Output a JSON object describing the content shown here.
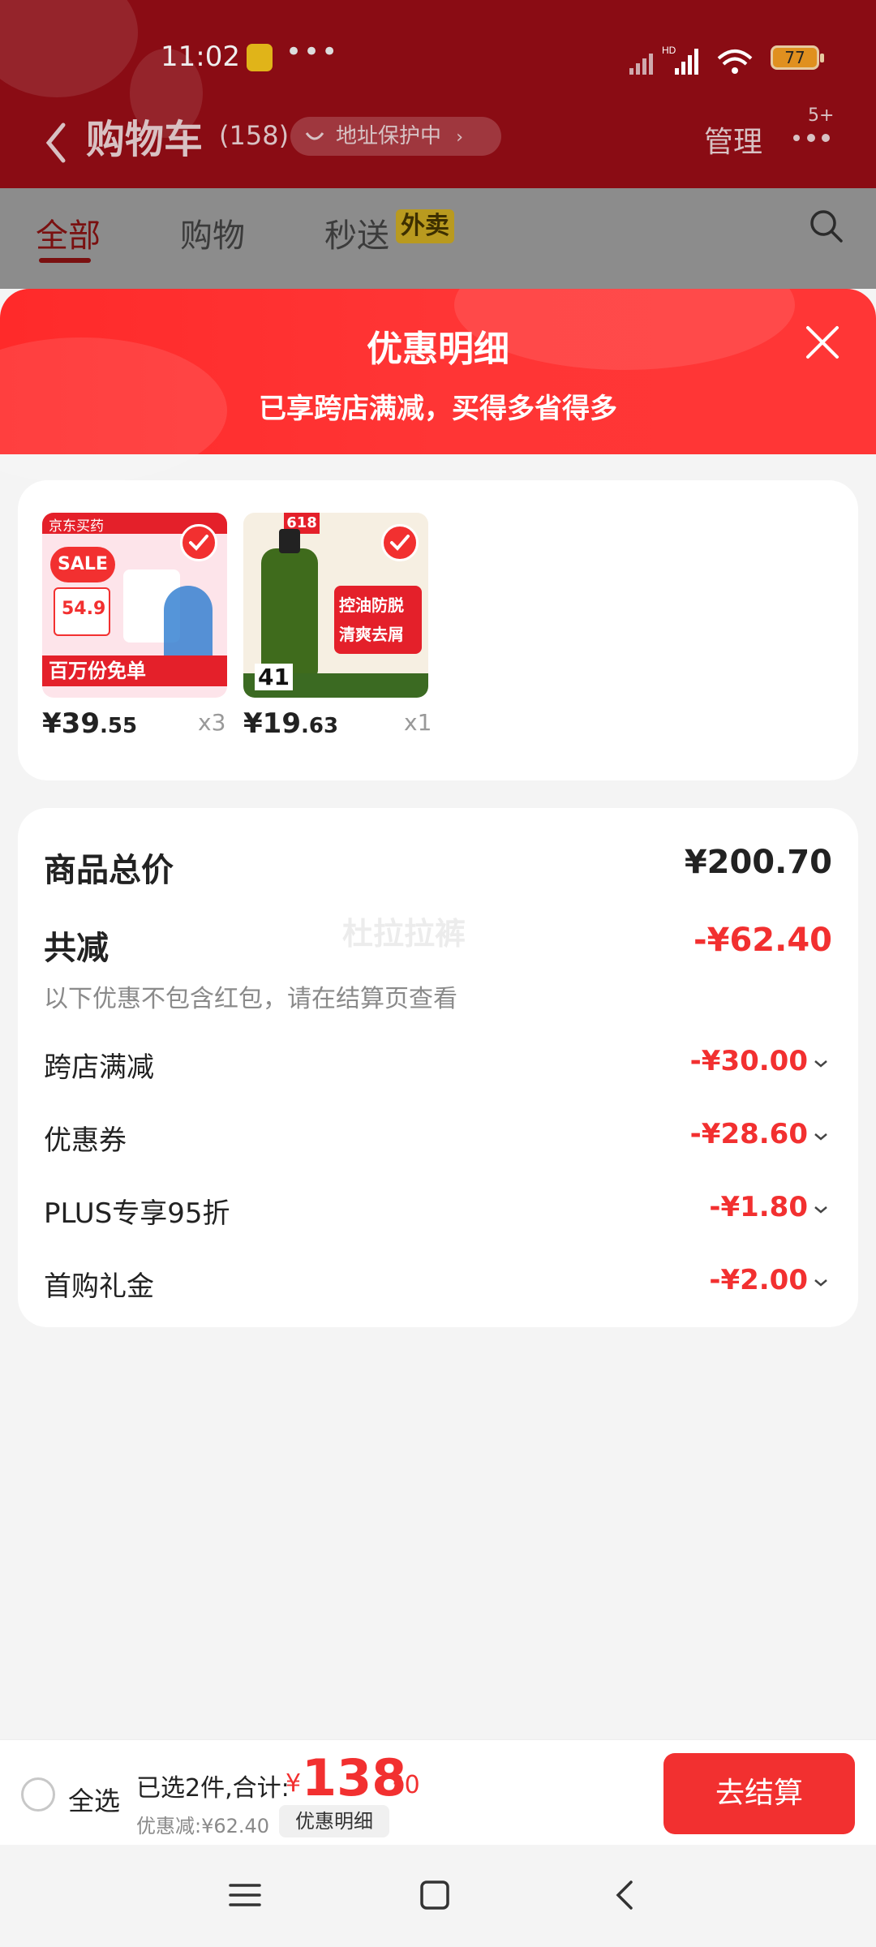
{
  "status_bar": {
    "time": "11:02",
    "dots": "•••",
    "network": "HD",
    "battery": "77"
  },
  "header": {
    "title": "购物车",
    "count": "(158)",
    "address": "地址保护中",
    "manage": "管理",
    "more_badge": "5+"
  },
  "tabs": [
    {
      "label": "全部"
    },
    {
      "label": "购物"
    },
    {
      "label": "秒送"
    }
  ],
  "tab_badge": "外卖",
  "sheet": {
    "title": "优惠明细",
    "subtitle": "已享跨店满减，买得多省得多"
  },
  "goods": [
    {
      "price_int": "¥39",
      "price_dec": ".55",
      "qty": "x3",
      "banner": "京东买药",
      "tag": "SALE",
      "promo": "百万份免单",
      "img_price": "54.9"
    },
    {
      "price_int": "¥19",
      "price_dec": ".63",
      "qty": "x1",
      "tag": "618",
      "promo": "控油防脱 清爽去屑",
      "img_price": "41"
    }
  ],
  "summary": {
    "total_label": "商品总价",
    "total_value": "¥200.70",
    "discount_label": "共减",
    "discount_value": "-¥62.40",
    "note": "以下优惠不包含红包，请在结算页查看",
    "watermark": "杜拉拉裤",
    "rows": [
      {
        "label": "跨店满减",
        "value": "-¥30.00"
      },
      {
        "label": "优惠券",
        "value": "-¥28.60"
      },
      {
        "label": "PLUS专享95折",
        "value": "-¥1.80"
      },
      {
        "label": "首购礼金",
        "value": "-¥2.00"
      }
    ]
  },
  "bottom": {
    "select_all": "全选",
    "selected": "已选2件,合计:",
    "yen": "¥",
    "total_int": "138",
    "total_dec": ".30",
    "discount": "优惠减:¥62.40",
    "detail_button": "优惠明细",
    "checkout": "去结算"
  },
  "colors": {
    "accent": "#f23030",
    "header_bg": "#8a0c14"
  }
}
